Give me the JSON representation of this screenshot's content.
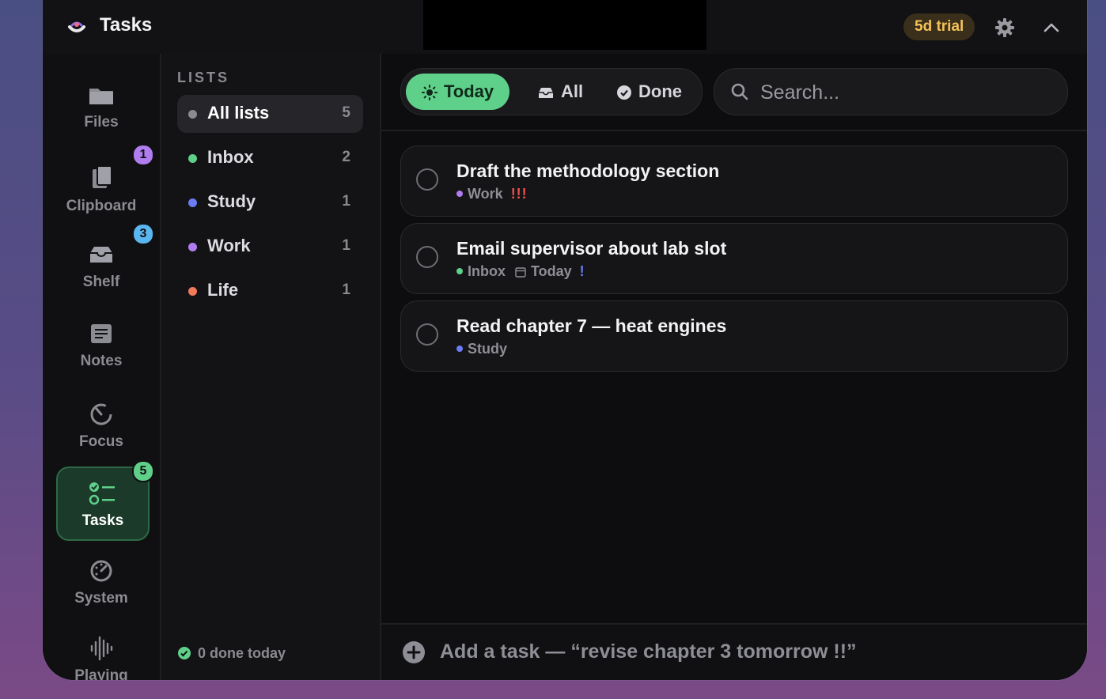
{
  "titlebar": {
    "app_title": "Tasks",
    "trial_label": "5d trial"
  },
  "rail": {
    "items": [
      {
        "label": "Files",
        "icon": "folder-icon"
      },
      {
        "label": "Clipboard",
        "icon": "clipboard-icon",
        "badge": "1",
        "badge_color": "#b07cf0"
      },
      {
        "label": "Shelf",
        "icon": "tray-icon",
        "badge": "3",
        "badge_color": "#5ab6f0"
      },
      {
        "label": "Notes",
        "icon": "note-icon"
      },
      {
        "label": "Focus",
        "icon": "timer-icon"
      },
      {
        "label": "Tasks",
        "icon": "checklist-icon",
        "badge": "5",
        "badge_color": "#5fd08a",
        "active": true
      },
      {
        "label": "System",
        "icon": "gauge-icon"
      },
      {
        "label": "Playing",
        "icon": "waveform-icon"
      }
    ]
  },
  "lists": {
    "heading": "LISTS",
    "items": [
      {
        "name": "All lists",
        "count": "5",
        "color": "#8a8a90",
        "active": true
      },
      {
        "name": "Inbox",
        "count": "2",
        "color": "#5fd08a"
      },
      {
        "name": "Study",
        "count": "1",
        "color": "#6b7cf5"
      },
      {
        "name": "Work",
        "count": "1",
        "color": "#b07cf0"
      },
      {
        "name": "Life",
        "count": "1",
        "color": "#f07a5a"
      }
    ],
    "done_today": "0 done today"
  },
  "filters": {
    "today": "Today",
    "all": "All",
    "done": "Done",
    "active": "today"
  },
  "search": {
    "placeholder": "Search..."
  },
  "tasks": [
    {
      "title": "Draft the methodology section",
      "list": "Work",
      "list_color": "#b07cf0",
      "priority": "!!!",
      "due": ""
    },
    {
      "title": "Email supervisor about lab slot",
      "list": "Inbox",
      "list_color": "#5fd08a",
      "due": "Today",
      "priority": "!"
    },
    {
      "title": "Read chapter 7 — heat engines",
      "list": "Study",
      "list_color": "#6b7cf5",
      "priority": "",
      "due": ""
    }
  ],
  "add_task": {
    "placeholder": "Add a task — “revise chapter 3 tomorrow !!”"
  },
  "colors": {
    "accent": "#5fd08a",
    "trial_text": "#f3c25a",
    "priority_high": "#f0514f",
    "priority_low": "#6b7cf5"
  }
}
